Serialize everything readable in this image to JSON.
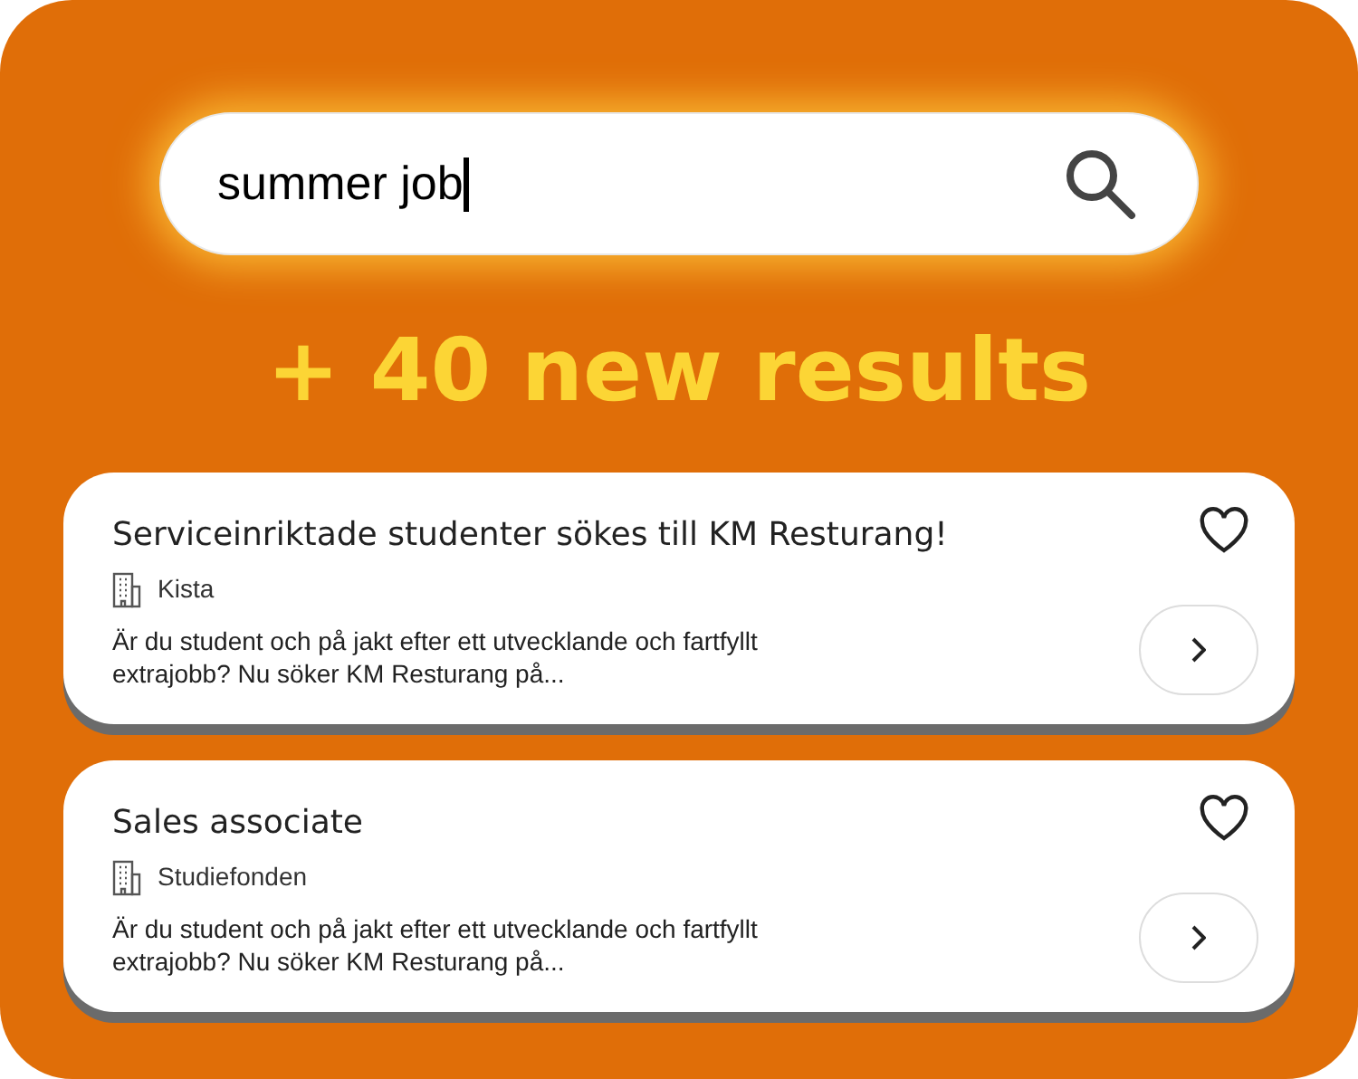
{
  "search": {
    "value": "summer job"
  },
  "results_heading": "+ 40 new results",
  "jobs": [
    {
      "title": "Serviceinriktade studenter sökes till KM Resturang!",
      "employer": "Kista",
      "description": "Är du student och på jakt efter ett utvecklande och fartfyllt extrajobb? Nu söker KM Resturang på..."
    },
    {
      "title": "Sales associate",
      "employer": "Studiefonden",
      "description": "Är du student och på jakt efter ett utvecklande och fartfyllt extrajobb? Nu söker KM Resturang på..."
    }
  ]
}
